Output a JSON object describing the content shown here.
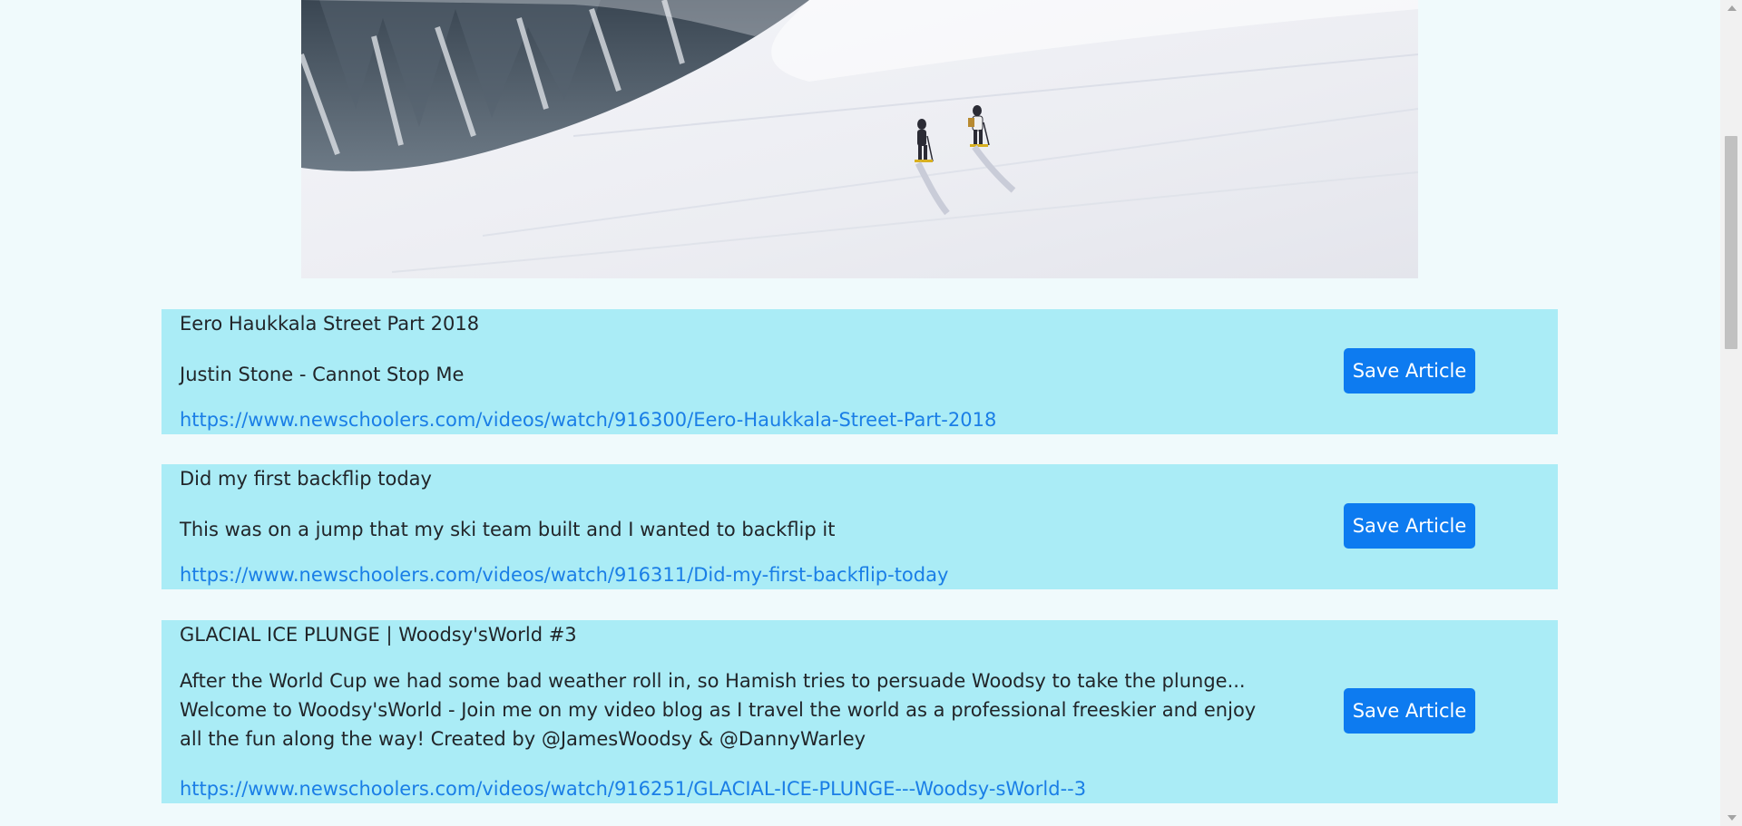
{
  "articles": [
    {
      "title": "Eero Haukkala Street Part 2018",
      "description": "Justin Stone - Cannot Stop Me",
      "link": "https://www.newschoolers.com/videos/watch/916300/Eero-Haukkala-Street-Part-2018",
      "button": "Save Article"
    },
    {
      "title": "Did my first backflip today",
      "description": "This was on a jump that my ski team built and I wanted to backflip it",
      "link": "https://www.newschoolers.com/videos/watch/916311/Did-my-first-backflip-today",
      "button": "Save Article"
    },
    {
      "title": "GLACIAL ICE PLUNGE | Woodsy'sWorld #3",
      "description": "After the World Cup we had some bad weather roll in, so Hamish tries to persuade Woodsy to take the plunge... Welcome to Woodsy'sWorld - Join me on my video blog as I travel the world as a professional freeskier and enjoy all the fun along the way! Created by @JamesWoodsy & @DannyWarley",
      "link": "https://www.newschoolers.com/videos/watch/916251/GLACIAL-ICE-PLUNGE---Woodsy-sWorld--3",
      "button": "Save Article"
    }
  ],
  "colors": {
    "page_background": "#f0fafc",
    "article_background": "#aaecf6",
    "button": "#0d7bf0",
    "link": "#1a7ee6"
  }
}
